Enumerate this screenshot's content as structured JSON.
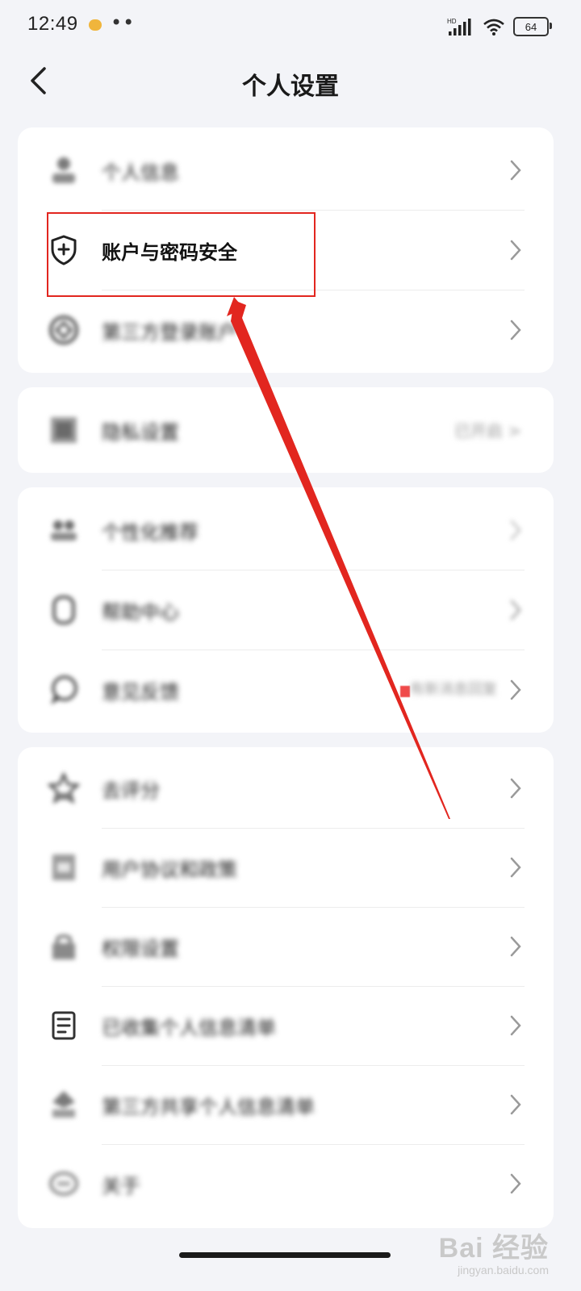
{
  "status_bar": {
    "time": "12:49",
    "dots": "••",
    "network": "HD",
    "battery": "64"
  },
  "header": {
    "title": "个人设置",
    "back_icon": "chevron-left-icon"
  },
  "cards": [
    {
      "rows": [
        {
          "label": "个人信息",
          "icon": "person-icon",
          "blurred": true,
          "chevron": true
        },
        {
          "label": "账户与密码安全",
          "icon": "shield-plus-icon",
          "blurred": false,
          "chevron": true,
          "highlighted": true
        },
        {
          "label": "第三方登录账户",
          "icon": "diamond-target-icon",
          "blurred": true,
          "chevron": true
        }
      ]
    },
    {
      "rows": [
        {
          "label": "隐私设置",
          "icon": "grid-icon",
          "blurred": true,
          "chevron": false,
          "value": "已开启 >"
        }
      ]
    },
    {
      "rows": [
        {
          "label": "个性化推荐",
          "icon": "people-icon",
          "blurred": true,
          "chevron": false
        },
        {
          "label": "帮助中心",
          "icon": "help-icon",
          "blurred": true,
          "chevron": true
        },
        {
          "label": "意见反馈",
          "icon": "chat-icon",
          "blurred": true,
          "chevron": true,
          "value": "有新消息回复",
          "badge_color": "#f04a4a"
        }
      ]
    },
    {
      "rows": [
        {
          "label": "去评分",
          "icon": "star-icon",
          "blurred": true,
          "chevron": true
        },
        {
          "label": "用户协议和政策",
          "icon": "document-icon",
          "blurred": true,
          "chevron": true
        },
        {
          "label": "权限设置",
          "icon": "lock-icon",
          "blurred": true,
          "chevron": true
        },
        {
          "label": "已收集个人信息清单",
          "icon": "list-icon",
          "blurred": true,
          "chevron": true
        },
        {
          "label": "第三方共享个人信息清单",
          "icon": "share-person-icon",
          "blurred": true,
          "chevron": true
        },
        {
          "label": "关于",
          "icon": "info-icon",
          "blurred": true,
          "chevron": true
        }
      ]
    }
  ],
  "annotation": {
    "box_color": "#e2261f",
    "arrow_color": "#e2261f"
  },
  "watermark": {
    "main": "Bai 经验",
    "sub": "jingyan.baidu.com"
  },
  "colors": {
    "background": "#f3f4f8",
    "card": "#ffffff",
    "chevron": "#9a9a9a"
  }
}
